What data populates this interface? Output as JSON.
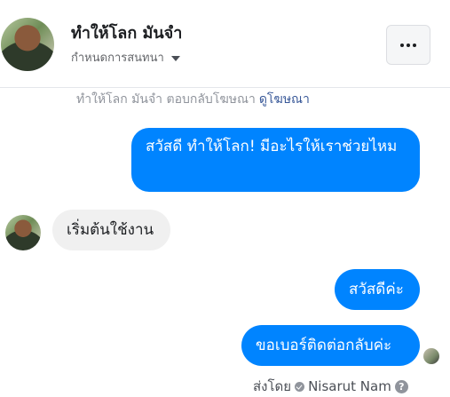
{
  "header": {
    "page_name": "ทำให้โลก มันจำ",
    "settings_label": "กำหนดการสนทนา"
  },
  "notice": {
    "text": "ทำให้โลก มันจำ ตอบกลับโฆษณา",
    "link": "ดูโฆษณา"
  },
  "messages": [
    {
      "direction": "outgoing",
      "text": "สวัสดี ทำให้โลก! มีอะไรให้เราช่วยไหม"
    },
    {
      "direction": "incoming",
      "text": "เริ่มต้นใช้งาน"
    },
    {
      "direction": "outgoing",
      "text": "สวัสดีค่ะ"
    },
    {
      "direction": "outgoing",
      "text": "ขอเบอร์ติดต่อกลับค่ะ"
    }
  ],
  "footer": {
    "sent_by_label": "ส่งโดย",
    "sender_name": "Nisarut Nam"
  },
  "colors": {
    "outgoing_bubble": "#0084ff",
    "incoming_bubble": "#f0f0f0",
    "link": "#385898"
  },
  "icons": [
    "more-icon",
    "chevron-down-icon",
    "verified-check-icon",
    "help-icon"
  ]
}
